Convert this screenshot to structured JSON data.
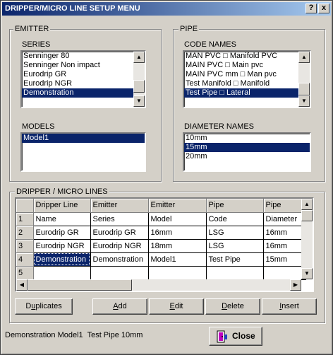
{
  "window": {
    "title": "DRIPPER/MICRO LINE SETUP MENU",
    "help_label": "?",
    "close_label": "x"
  },
  "emitter": {
    "group_label": "EMITTER",
    "series_label": "SERIES",
    "series": [
      {
        "label": "Senninger 80",
        "selected": false
      },
      {
        "label": "Senninger Non impact",
        "selected": false
      },
      {
        "label": "Eurodrip GR",
        "selected": false
      },
      {
        "label": "Eurodrip NGR",
        "selected": false
      },
      {
        "label": "Demonstration",
        "selected": true
      }
    ],
    "models_label": "MODELS",
    "models": [
      {
        "label": "Model1",
        "selected": true
      }
    ]
  },
  "pipe": {
    "group_label": "PIPE",
    "code_names_label": "CODE NAMES",
    "code_names": [
      {
        "label": "MAN PVC □ Manifold PVC",
        "selected": false
      },
      {
        "label": "MAIN PVC □ Main pvc",
        "selected": false
      },
      {
        "label": "MAIN PVC mm □ Man pvc",
        "selected": false
      },
      {
        "label": "Test Manifold □ Manifold",
        "selected": false
      },
      {
        "label": "Test Pipe □ Lateral",
        "selected": true
      }
    ],
    "diameter_names_label": "DIAMETER NAMES",
    "diameter_names": [
      {
        "label": "10mm",
        "selected": false
      },
      {
        "label": "15mm",
        "selected": true
      },
      {
        "label": "20mm",
        "selected": false
      }
    ]
  },
  "lines": {
    "group_label": "DRIPPER / MICRO  LINES",
    "header_row": [
      "",
      "Dripper Line",
      "Emitter",
      "Emitter",
      "Pipe",
      "Pipe"
    ],
    "rows": [
      [
        "1",
        "Name",
        "Series",
        "Model",
        "Code",
        "Diameter"
      ],
      [
        "2",
        "Eurodrip GR",
        "Eurodrip GR",
        "16mm",
        "LSG",
        "16mm"
      ],
      [
        "3",
        "Eurodrip NGR",
        "Eurodrip NGR",
        "18mm",
        "LSG",
        "16mm"
      ],
      [
        "4",
        "Demonstration",
        "Demonstration",
        "Model1",
        "Test Pipe",
        "15mm"
      ],
      [
        "5",
        "",
        "",
        "",
        "",
        ""
      ]
    ]
  },
  "buttons": {
    "duplicates": {
      "pre": "D",
      "ul": "u",
      "post": "plicates"
    },
    "add": {
      "pre": "",
      "ul": "A",
      "post": "dd"
    },
    "edit": {
      "pre": "",
      "ul": "E",
      "post": "dit"
    },
    "delete": {
      "pre": "",
      "ul": "D",
      "post": "elete"
    },
    "insert": {
      "pre": "",
      "ul": "I",
      "post": "nsert"
    },
    "close": {
      "pre": "",
      "ul": "C",
      "post": "lose"
    }
  },
  "status_text": "Demonstration Model1  Test Pipe 10mm"
}
